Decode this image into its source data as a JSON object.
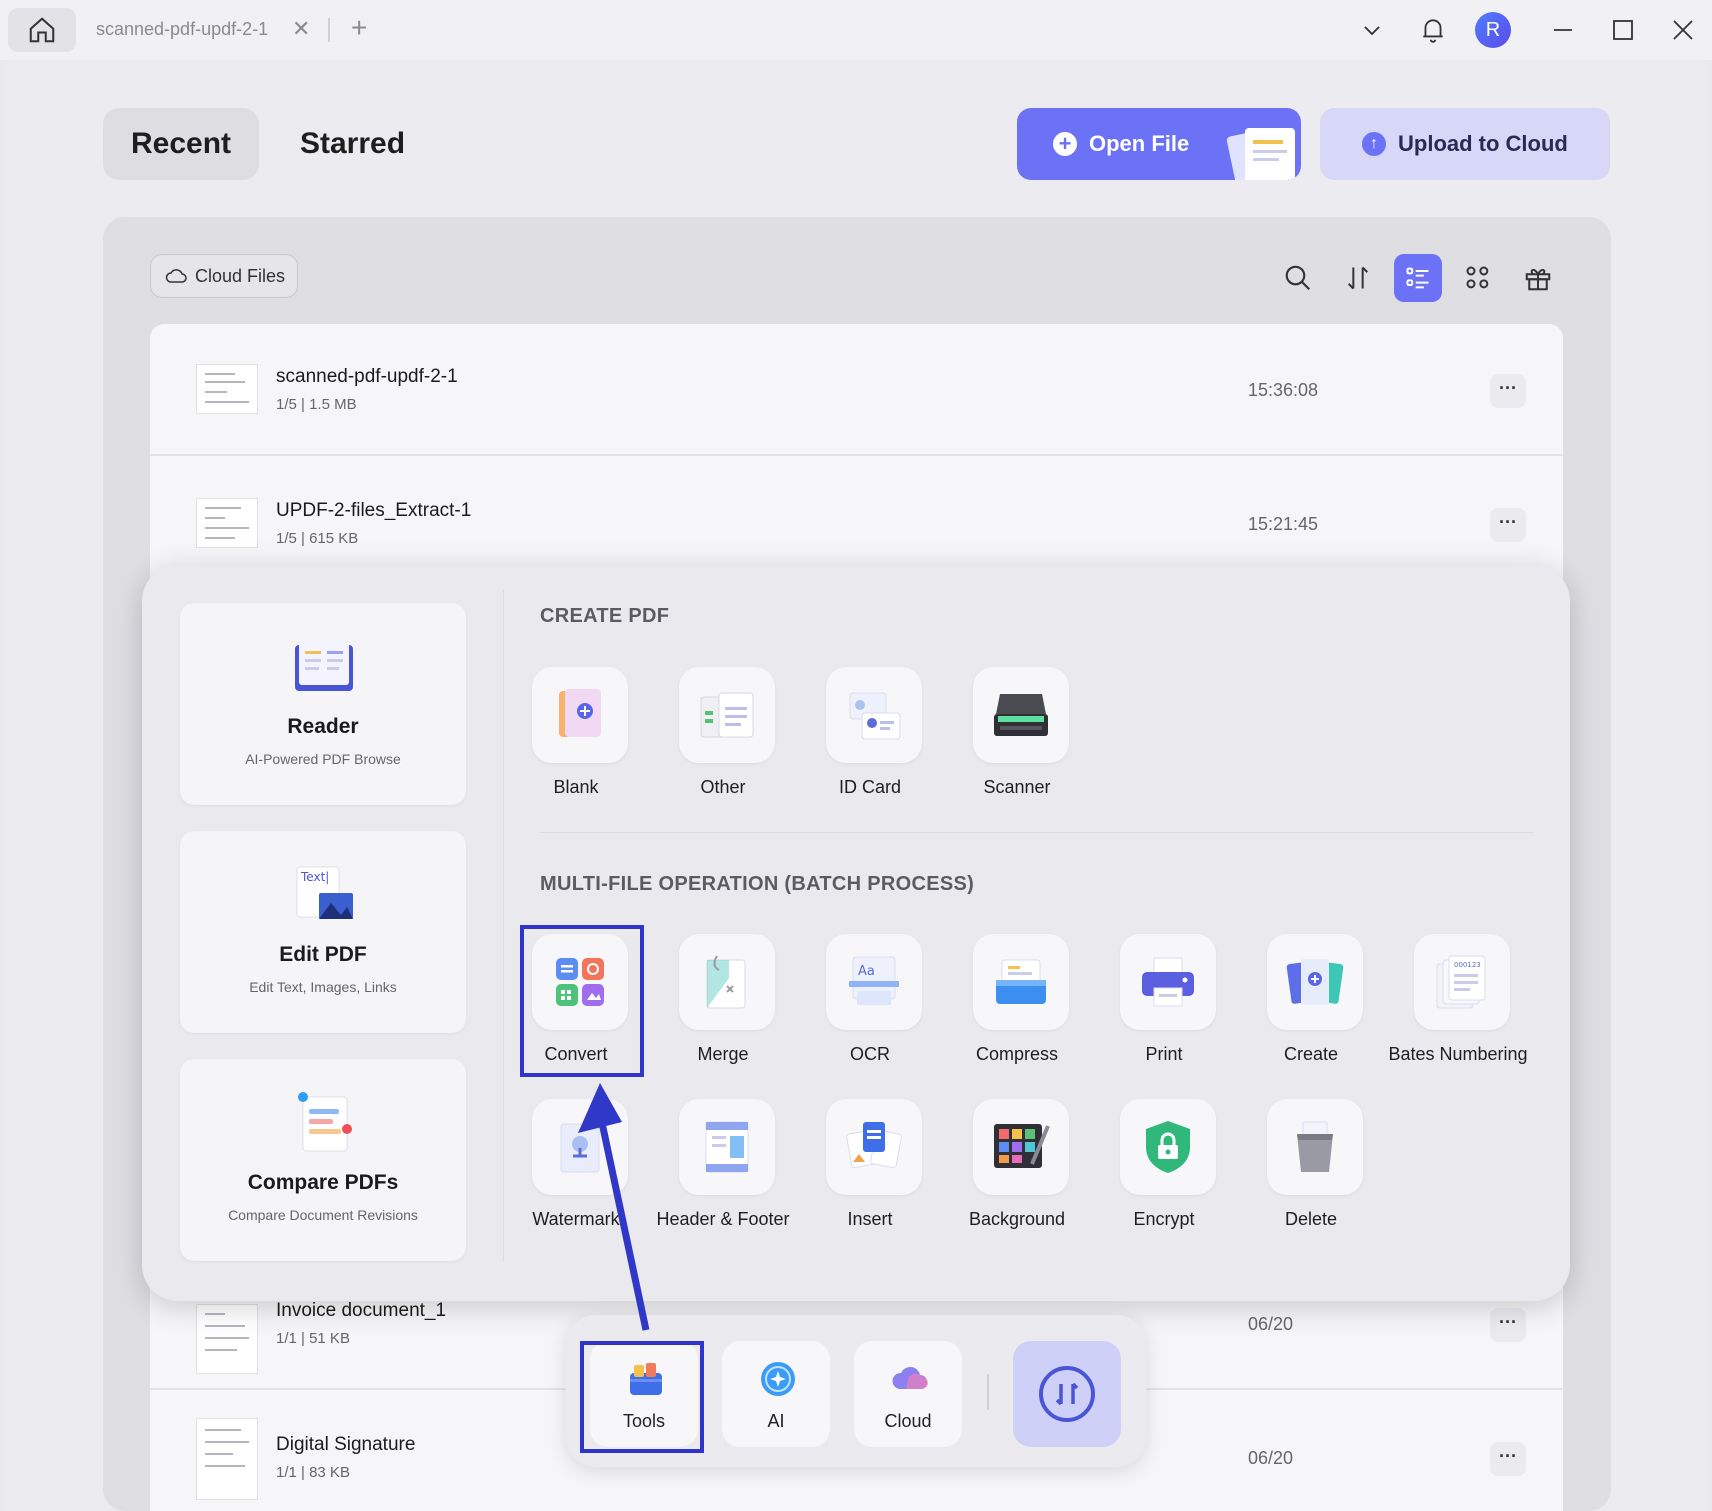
{
  "titlebar": {
    "tab_title": "scanned-pdf-updf-2-1",
    "tab_close": "✕",
    "tab_add": "+",
    "avatar_letter": "R"
  },
  "header": {
    "tabs": [
      "Recent",
      "Starred"
    ],
    "open_file_label": "Open File",
    "upload_label": "Upload to Cloud"
  },
  "toolbar": {
    "cloud_files_label": "Cloud Files",
    "icons": [
      "search-icon",
      "sort-icon",
      "list-view-icon",
      "grid-view-icon",
      "gift-icon"
    ],
    "active_view": "list"
  },
  "files": [
    {
      "name": "scanned-pdf-updf-2-1",
      "meta": "1/5 | 1.5 MB",
      "time": "15:36:08"
    },
    {
      "name": "UPDF-2-files_Extract-1",
      "meta": "1/5 | 615 KB",
      "time": "15:21:45"
    },
    {
      "name": "Invoice document_1",
      "meta": "1/1 | 51 KB",
      "time": "06/20"
    },
    {
      "name": "Digital Signature",
      "meta": "1/1 | 83 KB",
      "time": "06/20"
    }
  ],
  "more_label": "···",
  "side_cards": [
    {
      "title": "Reader",
      "subtitle": "AI-Powered PDF Browse"
    },
    {
      "title": "Edit PDF",
      "subtitle": "Edit Text, Images, Links"
    },
    {
      "title": "Compare PDFs",
      "subtitle": "Compare Document Revisions"
    }
  ],
  "create_pdf": {
    "title": "CREATE PDF",
    "items": [
      "Blank",
      "Other",
      "ID Card",
      "Scanner"
    ]
  },
  "batch": {
    "title": "MULTI-FILE OPERATION (BATCH PROCESS)",
    "row1": [
      "Convert",
      "Merge",
      "OCR",
      "Compress",
      "Print",
      "Create",
      "Bates Numbering"
    ],
    "row2": [
      "Watermark",
      "Header & Footer",
      "Insert",
      "Background",
      "Encrypt",
      "Delete"
    ]
  },
  "dock": {
    "items": [
      "Tools",
      "AI",
      "Cloud"
    ]
  },
  "colors": {
    "accent": "#6b72f5",
    "highlight": "#2e35c8"
  }
}
